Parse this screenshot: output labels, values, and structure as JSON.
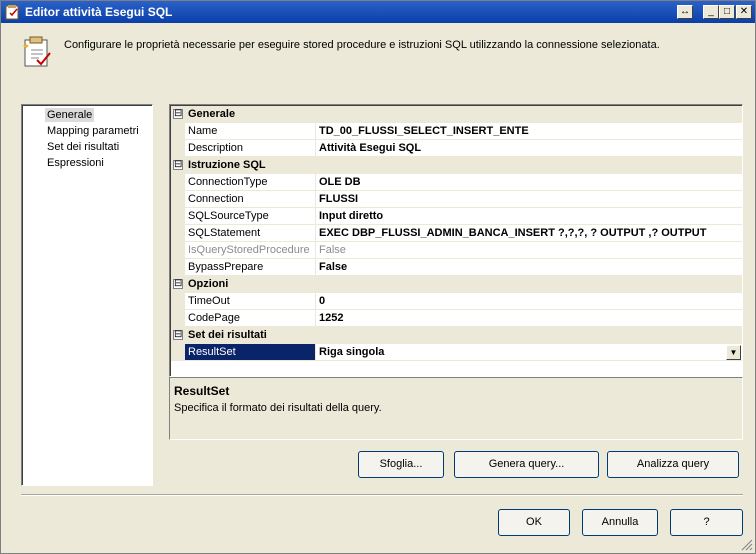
{
  "window": {
    "title": "Editor attività Esegui SQL",
    "controls": [
      "↔",
      "_",
      "□",
      "✕"
    ]
  },
  "header": {
    "description": "Configurare le proprietà necessarie per eseguire stored procedure e istruzioni SQL utilizzando la connessione selezionata."
  },
  "nav": {
    "items": [
      "Generale",
      "Mapping parametri",
      "Set dei risultati",
      "Espressioni"
    ],
    "selected": "Generale"
  },
  "grid": {
    "toggle_symbol": "⊟",
    "categories": [
      {
        "name": "Generale",
        "properties": [
          {
            "name": "Name",
            "value": "TD_00_FLUSSI_SELECT_INSERT_ENTE"
          },
          {
            "name": "Description",
            "value": "Attività Esegui SQL"
          }
        ]
      },
      {
        "name": "Istruzione SQL",
        "properties": [
          {
            "name": "ConnectionType",
            "value": "OLE DB"
          },
          {
            "name": "Connection",
            "value": "FLUSSI"
          },
          {
            "name": "SQLSourceType",
            "value": "Input diretto"
          },
          {
            "name": "SQLStatement",
            "value": "EXEC DBP_FLUSSI_ADMIN_BANCA_INSERT ?,?,?, ? OUTPUT ,? OUTPUT"
          },
          {
            "name": "IsQueryStoredProcedure",
            "value": "False"
          },
          {
            "name": "BypassPrepare",
            "value": "False"
          }
        ]
      },
      {
        "name": "Opzioni",
        "properties": [
          {
            "name": "TimeOut",
            "value": "0"
          },
          {
            "name": "CodePage",
            "value": "1252"
          }
        ]
      },
      {
        "name": "Set dei risultati",
        "properties": [
          {
            "name": "ResultSet",
            "value": "Riga singola"
          }
        ]
      }
    ],
    "dropdown_arrow": "▼"
  },
  "help": {
    "title": "ResultSet",
    "text": "Specifica il formato dei risultati della query."
  },
  "buttons": {
    "browse": "Sfoglia...",
    "build_query": "Genera query...",
    "parse_query": "Analizza query",
    "ok": "OK",
    "cancel": "Annulla",
    "help": "?"
  },
  "colors": {
    "titlebar": "#0a3fa8",
    "selection": "#0a246a",
    "face": "#ece9d8"
  }
}
